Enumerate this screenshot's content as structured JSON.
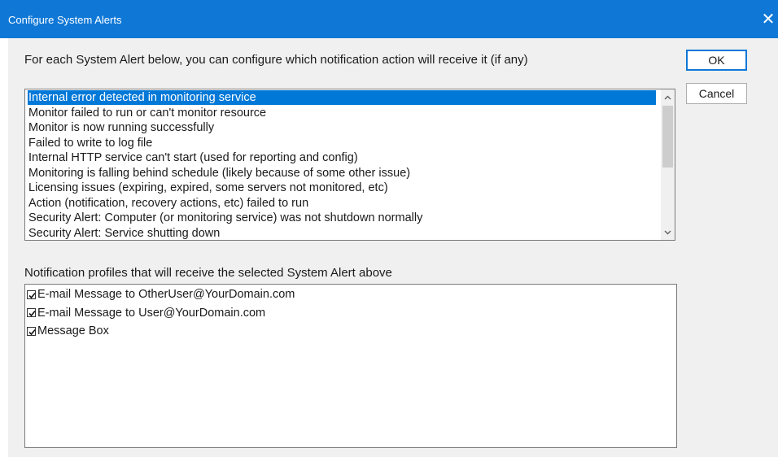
{
  "window": {
    "title": "Configure System Alerts",
    "close_glyph": "✕"
  },
  "prompt": "For each System Alert below, you can configure which notification action will receive it (if any)",
  "buttons": {
    "ok": "OK",
    "cancel": "Cancel"
  },
  "alerts": [
    {
      "label": "Internal error detected in monitoring service",
      "selected": true
    },
    {
      "label": "Monitor failed to run or can't monitor resource",
      "selected": false
    },
    {
      "label": "Monitor is now running successfully",
      "selected": false
    },
    {
      "label": "Failed to write to log file",
      "selected": false
    },
    {
      "label": "Internal HTTP service can't start (used for reporting and config)",
      "selected": false
    },
    {
      "label": "Monitoring is falling behind schedule (likely because of some other issue)",
      "selected": false
    },
    {
      "label": "Licensing issues (expiring, expired, some servers not monitored, etc)",
      "selected": false
    },
    {
      "label": "Action (notification, recovery actions, etc) failed to run",
      "selected": false
    },
    {
      "label": "Security Alert: Computer (or monitoring service) was not shutdown normally",
      "selected": false
    },
    {
      "label": "Security Alert: Service shutting down",
      "selected": false
    }
  ],
  "profiles_label": "Notification profiles that will receive the selected System Alert above",
  "profiles": [
    {
      "label": "E-mail Message to OtherUser@YourDomain.com",
      "checked": true
    },
    {
      "label": "E-mail Message to User@YourDomain.com",
      "checked": true
    },
    {
      "label": "Message Box",
      "checked": true
    }
  ],
  "icons": {
    "scroll_up": "chevron-up-icon",
    "scroll_down": "chevron-down-icon",
    "close": "close-icon"
  },
  "colors": {
    "titlebar": "#0f78d7",
    "selection": "#0078d7"
  }
}
